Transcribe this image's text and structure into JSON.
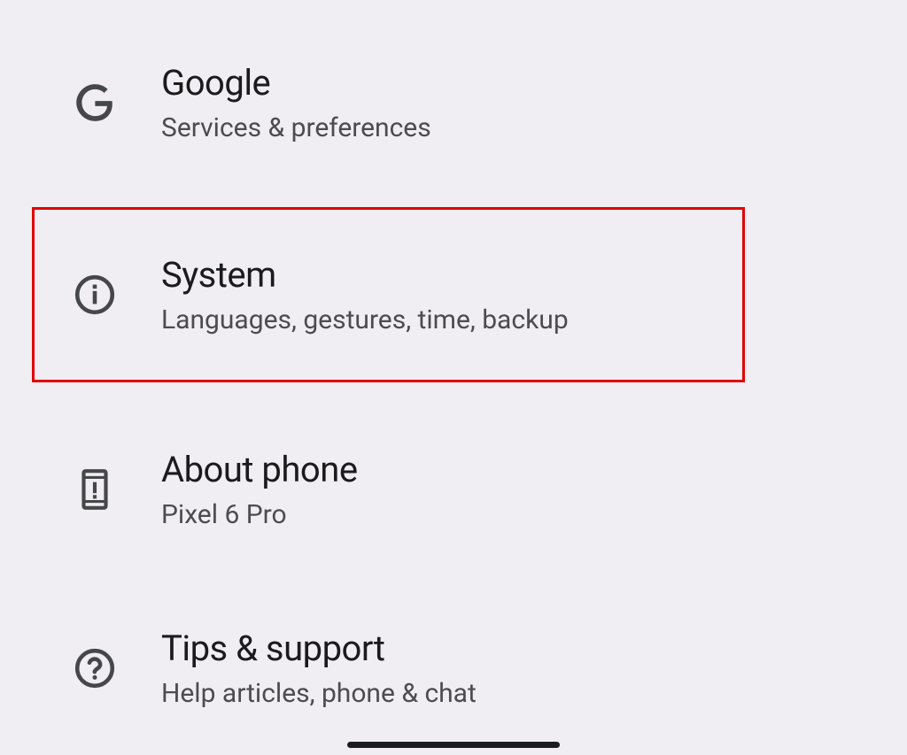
{
  "settings_items": [
    {
      "title": "Google",
      "subtitle": "Services & preferences",
      "icon": "google-icon",
      "highlighted": false
    },
    {
      "title": "System",
      "subtitle": "Languages, gestures, time, backup",
      "icon": "info-icon",
      "highlighted": true
    },
    {
      "title": "About phone",
      "subtitle": "Pixel 6 Pro",
      "icon": "phone-icon",
      "highlighted": false
    },
    {
      "title": "Tips & support",
      "subtitle": "Help articles, phone & chat",
      "icon": "help-icon",
      "highlighted": false
    }
  ]
}
